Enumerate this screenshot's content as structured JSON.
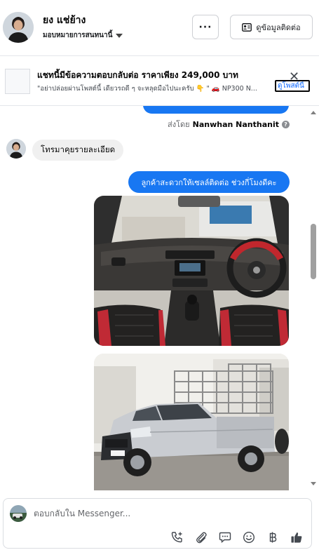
{
  "header": {
    "contact_name": "ยง แช่ย้าง",
    "assign_label": "มอบหมายการสนทนานี้",
    "more_label": "···",
    "contact_info_label": "ดูข้อมูลติดต่อ"
  },
  "banner": {
    "title": "แชทนี้มีข้อความตอบกลับต่อ ราคาเพียง 249,000 บาท",
    "subtitle": "\"อย่าปล่อยผ่านโพสต์นี้ เดียวรถดี ๆ จะหลุดมือไปนะครับ 👇 \" 🚗 NP300 N...",
    "link_label": "ดูโพสต์นี้",
    "close_label": "✕"
  },
  "thread": {
    "sent_by_prefix": "ส่งโดย",
    "sent_by_name": "Nanwhan Nanthanit",
    "info_glyph": "?",
    "incoming_message": "โทรมาคุยรายละเอียด",
    "outgoing_message": "ลูกค้าสะดวกให้เซลล์ติดต่อ ช่วงกี่โมงดีคะ"
  },
  "composer": {
    "placeholder": "ตอบกลับใน Messenger...",
    "tools": [
      "phone-plus-icon",
      "paperclip-icon",
      "chat-bubble-icon",
      "emoji-icon",
      "baht-icon",
      "thumbs-up-icon"
    ]
  },
  "colors": {
    "accent": "#1877f2",
    "incoming_bubble": "#f0f0f0",
    "border": "#dadde1"
  }
}
